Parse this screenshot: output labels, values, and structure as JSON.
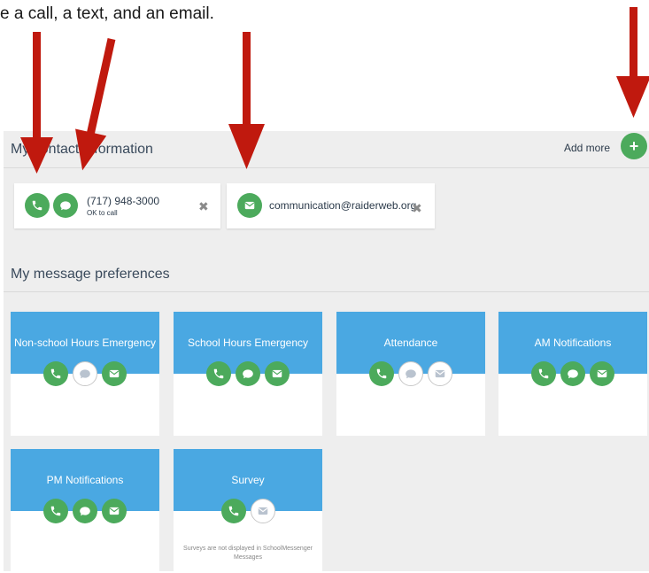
{
  "caption": "e a call, a text, and an email.",
  "contact_section": {
    "title": "My contact information",
    "add_more_label": "Add more",
    "add_icon": "+",
    "phone": {
      "number": "(717) 948-3000",
      "note": "OK to call",
      "remove_icon": "✖"
    },
    "email": {
      "address": "communication@raiderweb.org",
      "remove_icon": "✖"
    }
  },
  "preferences_section": {
    "title": "My message preferences",
    "cards": [
      {
        "title": "Non-school Hours Emergency",
        "channels": {
          "call": "on",
          "text": "off",
          "email": "on"
        }
      },
      {
        "title": "School Hours Emergency",
        "channels": {
          "call": "on",
          "text": "on",
          "email": "on"
        }
      },
      {
        "title": "Attendance",
        "channels": {
          "call": "on",
          "text": "off",
          "email": "off"
        }
      },
      {
        "title": "AM Notifications",
        "channels": {
          "call": "on",
          "text": "on",
          "email": "on"
        }
      },
      {
        "title": "PM Notifications",
        "channels": {
          "call": "on",
          "text": "on",
          "email": "on"
        }
      },
      {
        "title": "Survey",
        "channels": {
          "call": "on",
          "email": "off"
        },
        "note": "Surveys are not displayed in SchoolMessenger Messages"
      }
    ]
  },
  "colors": {
    "green": "#4caa5c",
    "blue_header": "#4aa8e2",
    "arrow_red": "#c0190e",
    "panel_bg": "#eeeeee"
  },
  "icons": [
    "phone-icon",
    "chat-bubble-icon",
    "envelope-icon",
    "close-icon",
    "plus-icon",
    "arrow-down-icon"
  ]
}
